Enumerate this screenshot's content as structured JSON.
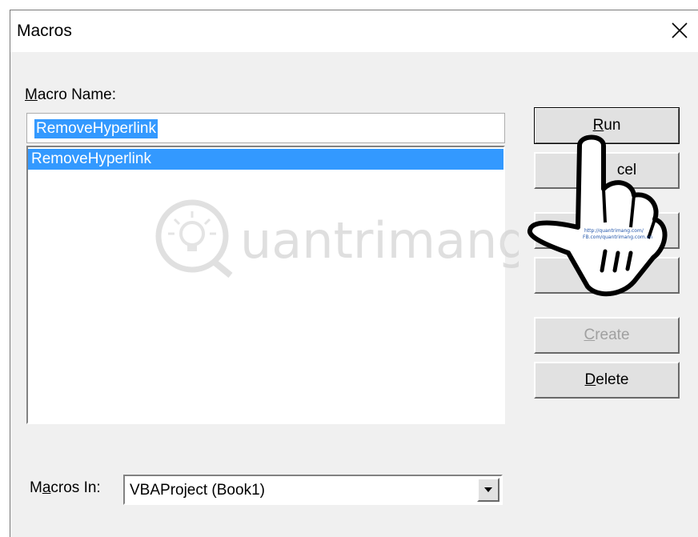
{
  "window": {
    "title": "Macros"
  },
  "macro_name": {
    "label_prefix": "",
    "label_access": "M",
    "label_rest": "acro Name:",
    "value": "RemoveHyperlink"
  },
  "macro_list": {
    "items": [
      "RemoveHyperlink"
    ]
  },
  "buttons": {
    "run": {
      "access": "R",
      "rest": "un"
    },
    "cancel": {
      "text": "cel"
    },
    "create": {
      "access": "C",
      "rest": "reate",
      "state": "disabled"
    },
    "delete": {
      "access": "D",
      "rest": "elete"
    }
  },
  "macros_in": {
    "label_pre": "M",
    "label_access": "a",
    "label_rest": "cros In:",
    "value": "VBAProject (Book1)"
  },
  "watermark": {
    "brand": "uantrimang",
    "hand_text_line1": "http://quantrimang.com/",
    "hand_text_line2": "FB.com/quantrimang.com.vn"
  },
  "colors": {
    "selection": "#3399ff",
    "dialog_bg": "#f0f0f0",
    "button_face": "#e1e1e1"
  },
  "icons": [
    "close-icon",
    "dropdown-arrow-icon",
    "lightbulb-icon",
    "pointing-hand-icon"
  ]
}
